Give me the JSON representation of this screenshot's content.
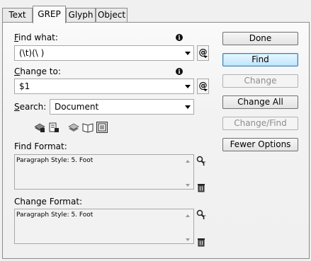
{
  "tabs": [
    {
      "label": "Text",
      "active": false
    },
    {
      "label": "GREP",
      "active": true
    },
    {
      "label": "Glyph",
      "active": false
    },
    {
      "label": "Object",
      "active": false
    }
  ],
  "find_what": {
    "label_u": "F",
    "label_rest": "ind what:",
    "value": "(\\t)(\\ )"
  },
  "change_to": {
    "label_u": "C",
    "label_rest": "hange to:",
    "value": "$1"
  },
  "search": {
    "label_u": "S",
    "label_rest": "earch:",
    "value": "Document"
  },
  "find_format": {
    "label": "Find Format:",
    "value": "Paragraph Style: 5. Foot"
  },
  "change_format": {
    "label": "Change Format:",
    "value": "Paragraph Style: 5. Foot"
  },
  "buttons": {
    "done": "Done",
    "find": "Find",
    "change": "Change",
    "change_all": "Change All",
    "change_find": "Change/Find",
    "fewer_options": "Fewer Options"
  },
  "icons": {
    "info": "i",
    "special_chars": "@"
  }
}
